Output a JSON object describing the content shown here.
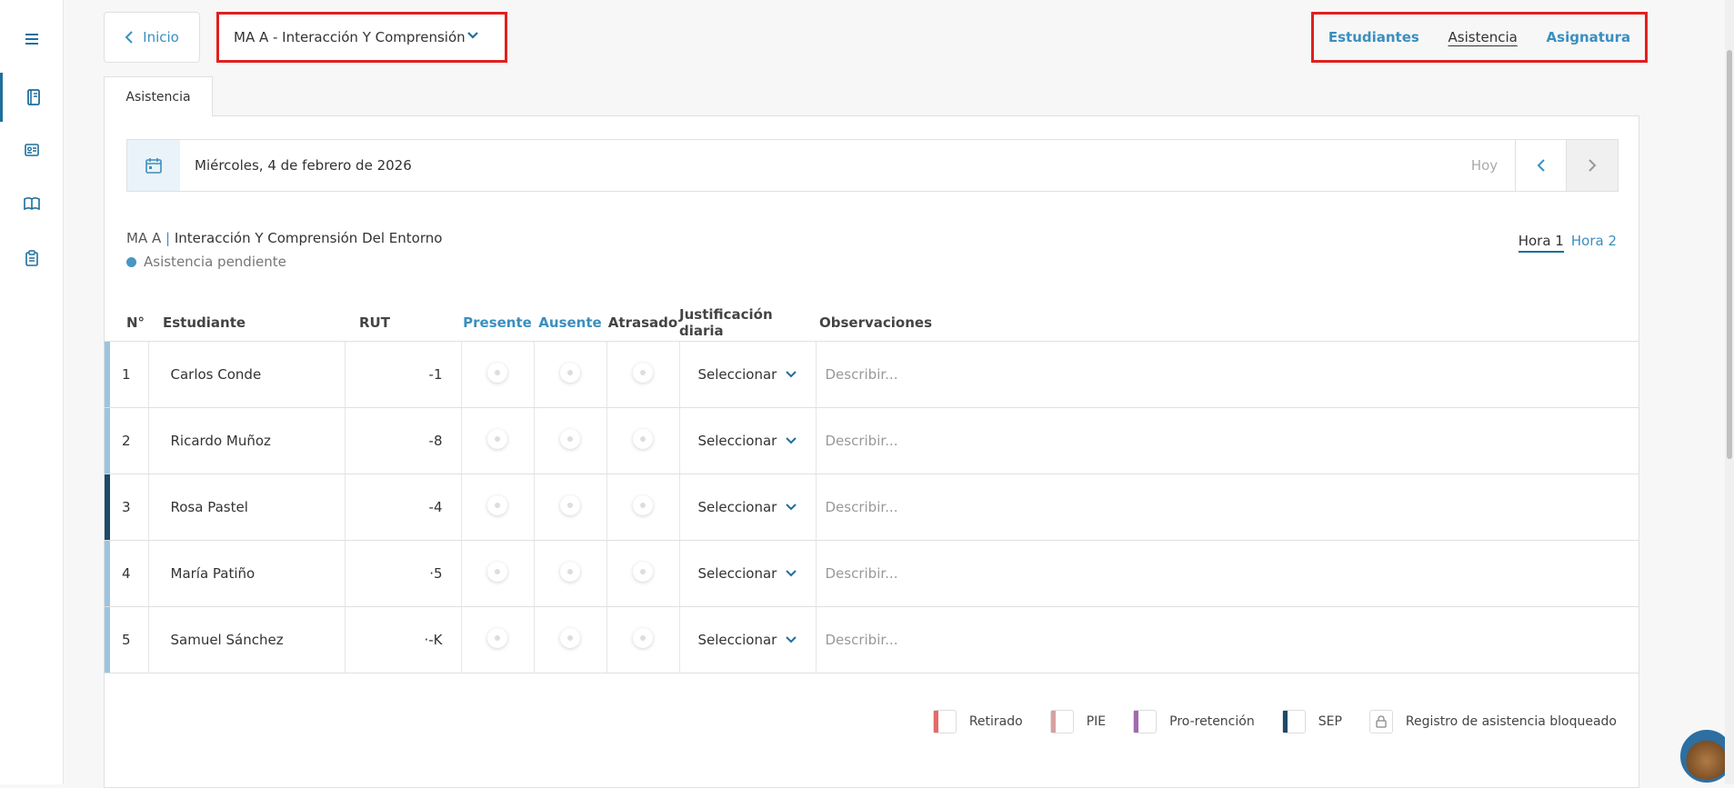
{
  "sidebar": {
    "items": [
      {
        "icon": "menu-icon"
      },
      {
        "icon": "notebook-icon",
        "active": true
      },
      {
        "icon": "id-card-icon"
      },
      {
        "icon": "book-icon"
      },
      {
        "icon": "clipboard-icon"
      }
    ]
  },
  "header": {
    "back_label": "Inicio",
    "course_label": "MA A - Interacción Y Comprensión",
    "nav": {
      "estudiantes": "Estudiantes",
      "asistencia": "Asistencia",
      "asignatura": "Asignatura"
    }
  },
  "tab": {
    "label": "Asistencia"
  },
  "datebar": {
    "date": "Miércoles, 4 de febrero de 2026",
    "today_label": "Hoy"
  },
  "info": {
    "course_code": "MA A",
    "subject": "Interacción Y Comprensión Del Entorno",
    "status": "Asistencia pendiente",
    "hour1": "Hora 1",
    "hour2": "Hora 2"
  },
  "table": {
    "headers": {
      "num": "N°",
      "student": "Estudiante",
      "rut": "RUT",
      "present": "Presente",
      "absent": "Ausente",
      "late": "Atrasado",
      "justification": "Justificación diaria",
      "observations": "Observaciones"
    },
    "rows": [
      {
        "num": "1",
        "name": "Carlos Conde",
        "rut": "-1",
        "select": "Seleccionar",
        "obs_placeholder": "Describir..."
      },
      {
        "num": "2",
        "name": "Ricardo Muñoz",
        "rut": "-8",
        "select": "Seleccionar",
        "obs_placeholder": "Describir..."
      },
      {
        "num": "3",
        "name": "Rosa Pastel",
        "rut": "-4",
        "select": "Seleccionar",
        "obs_placeholder": "Describir..."
      },
      {
        "num": "4",
        "name": "María Patiño",
        "rut": "·5",
        "select": "Seleccionar",
        "obs_placeholder": "Describir..."
      },
      {
        "num": "5",
        "name": "Samuel Sánchez",
        "rut": "·-K",
        "select": "Seleccionar",
        "obs_placeholder": "Describir..."
      }
    ]
  },
  "legend": {
    "retirado": "Retirado",
    "pie": "PIE",
    "pro": "Pro-retención",
    "sep": "SEP",
    "locked": "Registro de asistencia bloqueado"
  },
  "colors": {
    "accent": "#3a8fc0",
    "highlight_border": "#e02020",
    "row_marker_light": "#9cc4de",
    "row_marker_dark": "#1c4a68"
  }
}
